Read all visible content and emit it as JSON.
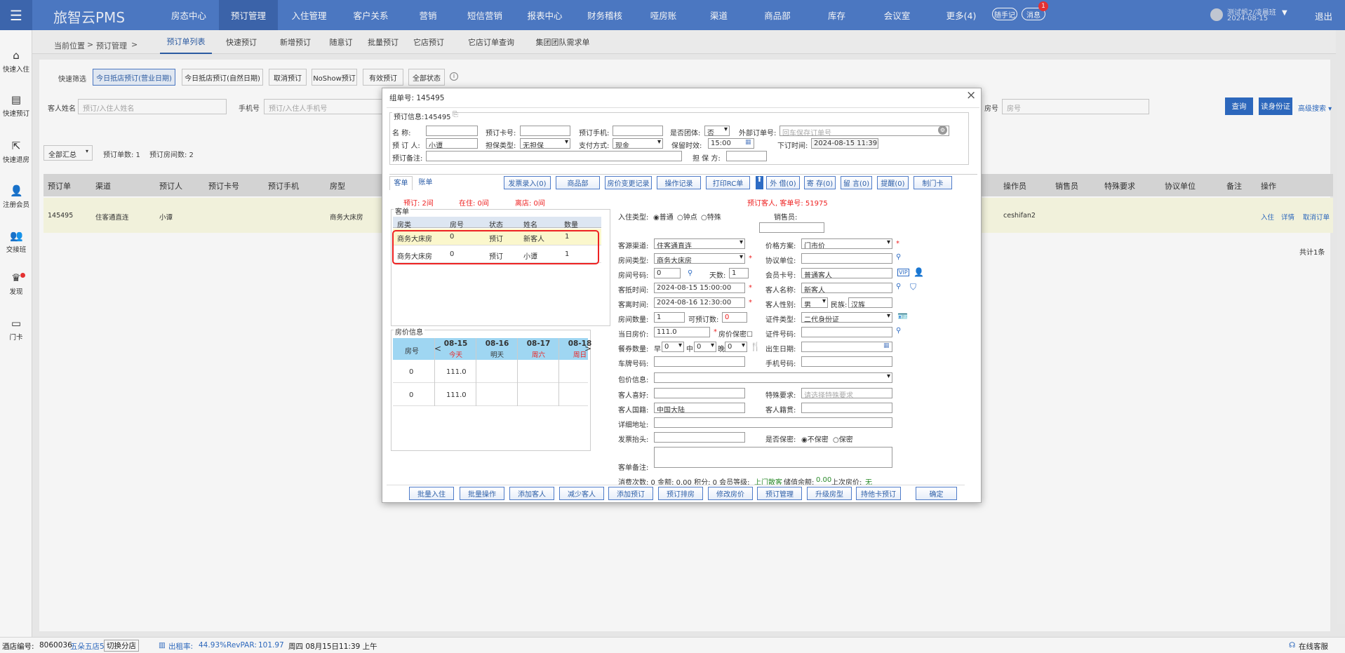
{
  "app": {
    "brand": "旅智云PMS"
  },
  "nav": [
    "房态中心",
    "预订管理",
    "入住管理",
    "客户关系",
    "营销",
    "短信营销",
    "报表中心",
    "财务稽核",
    "哑房账",
    "渠道",
    "商品部",
    "库存",
    "会议室",
    "更多(4)"
  ],
  "nav_active": 1,
  "header": {
    "memo_btn": "随手记",
    "msg_btn": "消息",
    "msg_count": "1",
    "user_name": "测试帆2/凌晨班",
    "user_date": "2024-08-15",
    "logout": "退出"
  },
  "sidebar": [
    {
      "label": "快速入住",
      "icon": "home-icon"
    },
    {
      "label": "快速预订",
      "icon": "document-icon"
    },
    {
      "label": "快速退房",
      "icon": "house-exit-icon"
    },
    {
      "label": "注册会员",
      "icon": "user-add-icon"
    },
    {
      "label": "交接班",
      "icon": "users-icon"
    },
    {
      "label": "发现",
      "icon": "discover-icon"
    },
    {
      "label": "门卡",
      "icon": "card-icon"
    }
  ],
  "breadcrumb": {
    "current": "当前位置",
    "sep": ">",
    "section": "预订管理",
    "sep2": ">"
  },
  "subtabs": [
    "预订单列表",
    "快速预订",
    "新增预订",
    "随意订",
    "批量预订",
    "它店预订",
    "它店订单查询",
    "集团团队需求单"
  ],
  "filters": {
    "quick_label": "快速筛选",
    "buttons": [
      "今日抵店预订(营业日期)",
      "今日抵店预订(自然日期)",
      "取消预订",
      "NoShow预订",
      "有效预订",
      "全部状态"
    ],
    "guest_label": "客人姓名",
    "guest_ph": "预订/入住人姓名",
    "phone_label": "手机号",
    "phone_ph": "预订/入住人手机号",
    "room_label": "房号",
    "room_ph": "房号",
    "search": "查询",
    "id_btn": "读身份证",
    "advanced": "高级搜索 ▾"
  },
  "summary": {
    "select": "全部汇总",
    "orders": "预订单数: 1",
    "rooms": "预订房间数: 2"
  },
  "table": {
    "headers": [
      "预订单",
      "渠道",
      "预订人",
      "预订卡号",
      "预订手机",
      "房型",
      "操作员",
      "销售员",
      "特殊要求",
      "协议单位",
      "备注",
      "操作"
    ],
    "row": {
      "id": "145495",
      "channel": "住客通直连",
      "booker": "小谭",
      "roomtype": "商务大床房",
      "operator": "ceshifan2",
      "actions": [
        "入住",
        "详情",
        "取消订单"
      ]
    },
    "total": "共计1条"
  },
  "status": {
    "hotel_label": "酒店编号:",
    "hotel_no": "8060036",
    "hotel_name": "五朵五店5",
    "switch": "切换分店",
    "occ_label": "出租率:",
    "occ": "44.93%",
    "revpar_label": "RevPAR:",
    "revpar": "101.97",
    "time": "周四 08月15日11:39 上午",
    "service": "在线客服"
  },
  "modal": {
    "title": "组单号: 145495",
    "section": "预订信息:145495",
    "f": {
      "name": "名    称:",
      "card": "预订卡号:",
      "phone": "预订手机:",
      "group": "是否团体:",
      "group_val": "否",
      "ext": "外部订单号:",
      "ext_ph": "回车保存订单号",
      "booker": "预 订 人:",
      "booker_val": "小谭",
      "guar_type": "担保类型:",
      "guar_val": "无担保",
      "pay": "支付方式:",
      "pay_val": "现金",
      "keep": "保留时效:",
      "keep_val": "15:00",
      "order_time": "下订时间:",
      "order_time_val": "2024-08-15 11:39:0",
      "remark": "预订备注:",
      "guarantor": "担 保 方:"
    },
    "tabs": [
      "客单",
      "账单"
    ],
    "actions": [
      "发票录入(0)",
      "商品部",
      "房价变更记录",
      "操作记录",
      "打印RC单"
    ],
    "actions2": [
      "外 借(0)",
      "寄 存(0)",
      "留 言(0)",
      "提醒(0)",
      "制门卡"
    ],
    "counts": {
      "booked": "预订: 2间",
      "inhouse": "在住: 0间",
      "out": "离店: 0间"
    },
    "guest_order": "预订客人, 客单号: 51975",
    "list_title": "客单",
    "list_cols": [
      "房类",
      "房号",
      "状态",
      "姓名",
      "数量"
    ],
    "list_rows": [
      [
        "商务大床房",
        "0",
        "预订",
        "新客人",
        "1"
      ],
      [
        "商务大床房",
        "0",
        "预订",
        "小谭",
        "1"
      ]
    ],
    "price_title": "房价信息",
    "price_room_col": "房号",
    "dates": [
      {
        "d": "08-15",
        "w": "今天"
      },
      {
        "d": "08-16",
        "w": "明天"
      },
      {
        "d": "08-17",
        "w": "周六"
      },
      {
        "d": "08-18",
        "w": "周日"
      }
    ],
    "price_rows": [
      [
        "0",
        "111.0"
      ],
      [
        "0",
        "111.0"
      ]
    ],
    "form": {
      "stay_type": "入住类型:",
      "stay_opts": [
        "普通",
        "钟点",
        "特殊"
      ],
      "sales": "销售员:",
      "source": "客源渠道:",
      "source_val": "住客通直连",
      "rate": "价格方案:",
      "rate_val": "门市价",
      "rtype": "房间类型:",
      "rtype_val": "商务大床房",
      "agree": "协议单位:",
      "rno": "房间号码:",
      "rno_val": "0",
      "days": "天数:",
      "days_val": "1",
      "member": "会员卡号:",
      "member_val": "普通客人",
      "vip": "VIP",
      "arrive": "客抵时间:",
      "arrive_val": "2024-08-15 15:00:00",
      "gname": "客人名称:",
      "gname_val": "新客人",
      "leave": "客离时间:",
      "leave_val": "2024-08-16 12:30:00",
      "gender": "客人性别:",
      "gender_val": "男",
      "nation": "民族:",
      "nation_val": "汉族",
      "rooms": "房间数量:",
      "rooms_val": "1",
      "avail": "可预订数:",
      "avail_val": "0",
      "idtype": "证件类型:",
      "idtype_val": "二代身份证",
      "dayprice": "当日房价:",
      "dayprice_val": "111.0",
      "secret_price": "房价保密",
      "idno": "证件号码:",
      "meals": "餐券数量:",
      "b": "早",
      "b_val": "0",
      "l": "中",
      "l_val": "0",
      "d": "晚",
      "d_val": "0",
      "birth": "出生日期:",
      "plate": "车牌号码:",
      "mobile": "手机号码:",
      "package": "包价信息:",
      "pref": "客人喜好:",
      "special": "特殊要求:",
      "special_ph": "请选择特殊要求",
      "country": "客人国籍:",
      "country_val": "中国大陆",
      "native": "客人籍贯:",
      "address": "详细地址:",
      "invoice": "发票抬头:",
      "secret": "是否保密:",
      "secret_opts": [
        "不保密",
        "保密"
      ],
      "note": "客单备注:",
      "stats": "消费次数: 0 金额: 0.00 积分: 0 会员等级:",
      "level": "上门散客",
      "balance_label": "储值余额:",
      "balance": "0.00",
      "last_label": "上次房价:",
      "last": "无"
    },
    "footer": [
      "批量入住",
      "批量操作",
      "添加客人",
      "减少客人",
      "添加预订",
      "预订排房",
      "修改房价",
      "预订管理",
      "升级房型",
      "持他卡预订",
      "确定"
    ]
  }
}
